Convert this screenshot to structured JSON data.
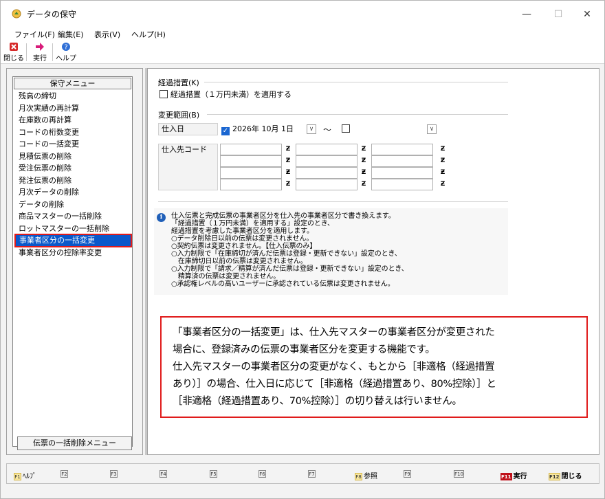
{
  "window": {
    "title": "データの保守",
    "minimize": "—",
    "maximize": "☐",
    "close": "✕"
  },
  "menubar": [
    {
      "label": "ファイル(F)"
    },
    {
      "label": "編集(E)"
    },
    {
      "label": "表示(V)"
    },
    {
      "label": "ヘルプ(H)"
    }
  ],
  "toolbar": {
    "close_label": "閉じる",
    "run_label": "実行",
    "help_label": "ヘルプ"
  },
  "sidemenu": {
    "header": "保守メニュー",
    "items": [
      "残高の締切",
      "月次実績の再計算",
      "在庫数の再計算",
      "コードの桁数変更",
      "コードの一括変更",
      "見積伝票の削除",
      "受注伝票の削除",
      "発注伝票の削除",
      "月次データの削除",
      "データの削除",
      "商品マスターの一括削除",
      "ロットマスターの一括削除",
      "事業者区分の一括変更",
      "事業者区分の控除率変更"
    ],
    "selected_index": 12,
    "bottom_tab": "伝票の一括削除メニュー"
  },
  "form": {
    "transition_title": "経過措置(K)",
    "transition_checkbox": "経過措置（１万円未満）を適用する",
    "range_title": "変更範囲(B)",
    "purchase_date_label": "仕入日",
    "date_from": "2026年 10月  1日",
    "tilde": "〜",
    "supplier_code_label": "仕入先コード",
    "z_glyph": "Ƶ",
    "dropdown_glyph": "∨",
    "check_glyph": "✓"
  },
  "info": {
    "icon": "i",
    "lines": [
      "仕入伝票と完成伝票の事業者区分を仕入先の事業者区分で書き換えます。",
      "「経過措置（１万円未満）を適用する」設定のとき、",
      "経過措置を考慮した事業者区分を適用します。",
      "○データ削除日以前の伝票は変更されません。",
      "○契約伝票は変更されません。【仕入伝票のみ】",
      "○入力制限で「在庫締切が済んだ伝票は登録・更新できない」設定のとき、",
      "　在庫締切日以前の伝票は変更されません。",
      "○入力制限で「請求／精算が済んだ伝票は登録・更新できない」設定のとき、",
      "　精算済の伝票は変更されません。",
      "○承認権レベルの高いユーザーに承認されている伝票は変更されません。"
    ]
  },
  "callout": {
    "lines": [
      "「事業者区分の一括変更」は、仕入先マスターの事業者区分が変更された",
      "場合に、登録済みの伝票の事業者区分を変更する機能です。",
      "仕入先マスターの事業者区分の変更がなく、もとから［非適格（経過措置",
      "あり）］の場合、仕入日に応じて［非適格（経過措置あり、80%控除）］と",
      "［非適格（経過措置あり、70%控除）］の切り替えは行いません。"
    ]
  },
  "fkeys": [
    {
      "key": "F1",
      "label": "ﾍﾙﾌﾟ"
    },
    {
      "key": "F2",
      "label": ""
    },
    {
      "key": "F3",
      "label": ""
    },
    {
      "key": "F4",
      "label": ""
    },
    {
      "key": "F5",
      "label": ""
    },
    {
      "key": "F6",
      "label": ""
    },
    {
      "key": "F7",
      "label": ""
    },
    {
      "key": "F8",
      "label": "参照"
    },
    {
      "key": "F9",
      "label": ""
    },
    {
      "key": "F10",
      "label": ""
    },
    {
      "key": "F11",
      "label": "実行"
    },
    {
      "key": "F12",
      "label": "閉じる"
    }
  ],
  "colors": {
    "selection": "#0a58ca",
    "callout_border": "#e01b1b",
    "info_icon": "#1f5fb8",
    "accent_check": "#1a66d1"
  }
}
